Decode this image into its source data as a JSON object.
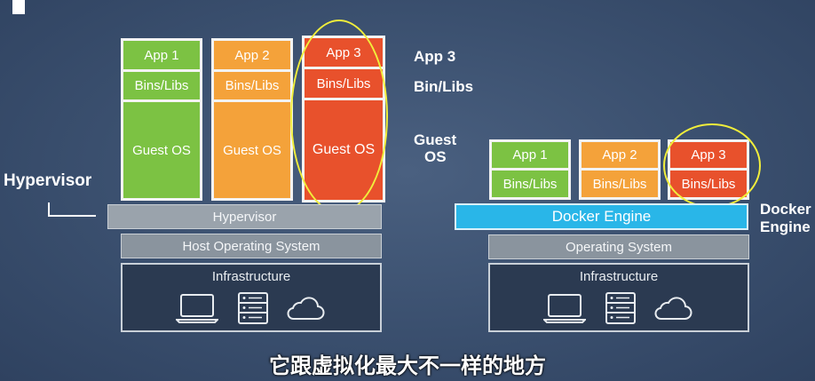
{
  "vm": {
    "apps": [
      {
        "app": "App 1",
        "bins": "Bins/Libs",
        "os": "Guest OS"
      },
      {
        "app": "App 2",
        "bins": "Bins/Libs",
        "os": "Guest OS"
      },
      {
        "app": "App 3",
        "bins": "Bins/Libs",
        "os": "Guest OS"
      }
    ],
    "hypervisor_bar": "Hypervisor",
    "host_os": "Host Operating System",
    "infrastructure": "Infrastructure",
    "legend": {
      "app": "App 3",
      "bins": "Bin/Libs",
      "guest_os_line1": "Guest",
      "guest_os_line2": "OS"
    },
    "hypervisor_label": "Hypervisor"
  },
  "docker": {
    "apps": [
      {
        "app": "App 1",
        "bins": "Bins/Libs"
      },
      {
        "app": "App 2",
        "bins": "Bins/Libs"
      },
      {
        "app": "App 3",
        "bins": "Bins/Libs"
      }
    ],
    "engine": "Docker Engine",
    "os": "Operating System",
    "infrastructure": "Infrastructure",
    "engine_label_line1": "Docker",
    "engine_label_line2": "Engine"
  },
  "subtitle": "它跟虚拟化最大不一样的地方",
  "colors": {
    "app1": "#7cc243",
    "app2": "#f4a23a",
    "app3": "#e8512c",
    "docker_engine": "#29b6e8",
    "highlight": "#f1ee3b"
  },
  "icons": [
    "laptop-icon",
    "server-icon",
    "cloud-icon"
  ]
}
